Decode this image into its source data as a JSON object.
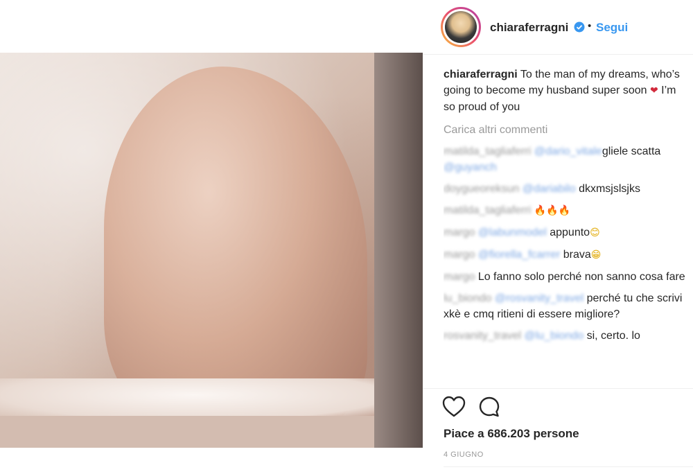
{
  "header": {
    "username": "chiaraferragni",
    "separator": "•",
    "follow_label": "Segui"
  },
  "caption": {
    "username": "chiaraferragni",
    "text": "To the man of my dreams, who’s going to become my husband super soon",
    "emoji": "❤",
    "text_after": "I’m so proud of you"
  },
  "load_more_label": "Carica altri commenti",
  "comments": [
    {
      "user": "matilda_tagliaferri",
      "mention": "@dario_vitale",
      "text": "gliele scatta",
      "mention2": "@guyanch"
    },
    {
      "user": "doygueoreksun",
      "mention": "@dariabilo",
      "text": "dkxmsjslsjks"
    },
    {
      "user": "matilda_tagliaferri",
      "text": "🔥🔥🔥"
    },
    {
      "user": "margo",
      "mention": "@labunmodel",
      "text": "appunto",
      "emoji": "😊"
    },
    {
      "user": "margo",
      "mention": "@fiorella_fcarrer",
      "text": "brava",
      "emoji": "😁"
    },
    {
      "user": "margo",
      "text": "Lo fanno solo perché non sanno cosa fare"
    },
    {
      "user": "lu_biondo",
      "mention": "@rosvanity_travel",
      "text": "perché tu che scrivi xkè e cmq ritieni di essere migliore?"
    },
    {
      "user": "rosvanity_travel",
      "mention": "@lu_biondo",
      "text": "si, certo. lo"
    }
  ],
  "likes_label": "Piace a 686.203 persone",
  "date_label": "4 GIUGNO",
  "colors": {
    "link": "#3897f0",
    "text": "#262626",
    "muted": "#999999"
  }
}
